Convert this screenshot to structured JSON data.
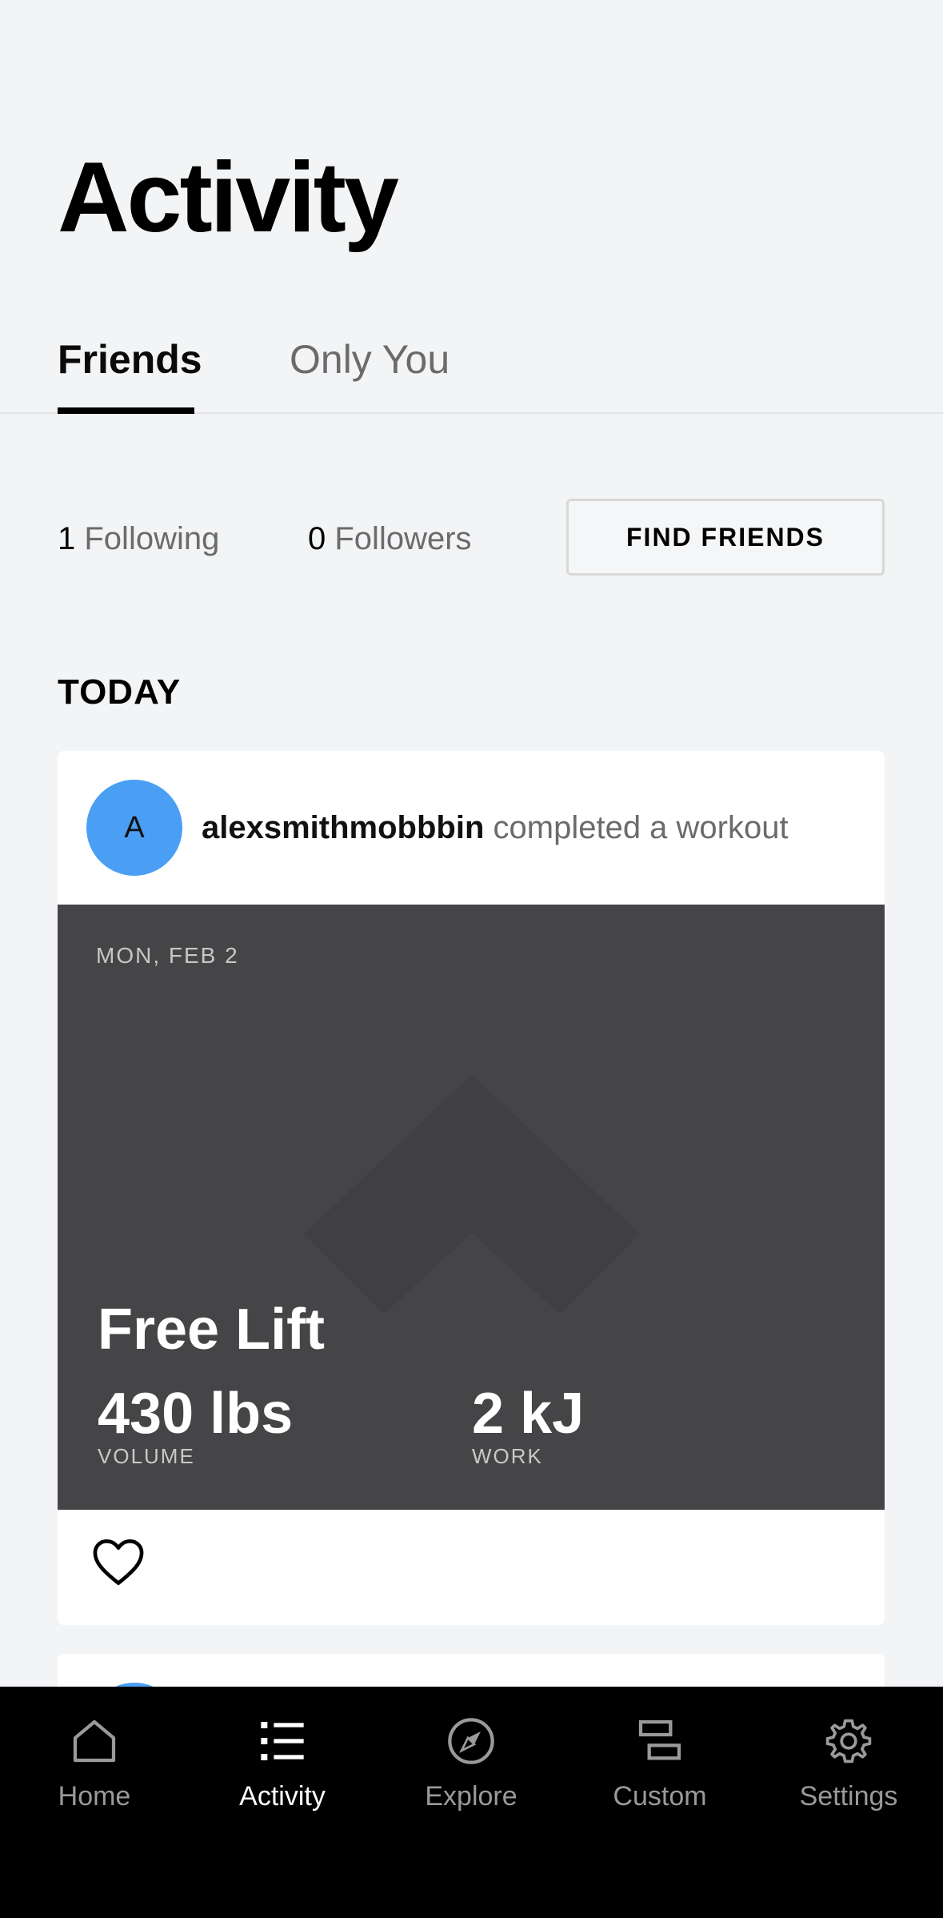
{
  "header": {
    "title": "Activity"
  },
  "tabs": [
    {
      "label": "Friends",
      "active": true
    },
    {
      "label": "Only You",
      "active": false
    }
  ],
  "social": {
    "following_count": "1",
    "following_label": "Following",
    "followers_count": "0",
    "followers_label": "Followers",
    "find_friends_label": "FIND FRIENDS"
  },
  "feed": {
    "section_title": "TODAY",
    "items": [
      {
        "avatar_initial": "A",
        "avatar_color": "#4a9ff5",
        "username": "alexsmithmobbbin",
        "action": "completed a workout",
        "date": "MON, FEB 2",
        "workout_name": "Free Lift",
        "volume_value": "430 lbs",
        "volume_label": "VOLUME",
        "work_value": "2 kJ",
        "work_label": "WORK",
        "icon": "heart-icon"
      }
    ]
  },
  "bottom_nav": [
    {
      "label": "Home",
      "icon": "home-icon",
      "active": false
    },
    {
      "label": "Activity",
      "icon": "list-icon",
      "active": true
    },
    {
      "label": "Explore",
      "icon": "compass-icon",
      "active": false
    },
    {
      "label": "Custom",
      "icon": "custom-icon",
      "active": false
    },
    {
      "label": "Settings",
      "icon": "gear-icon",
      "active": false
    }
  ],
  "colors": {
    "background": "#f3f4f6",
    "card_dark": "#454547",
    "avatar": "#4a9ff5",
    "nav_bg": "#000000"
  }
}
